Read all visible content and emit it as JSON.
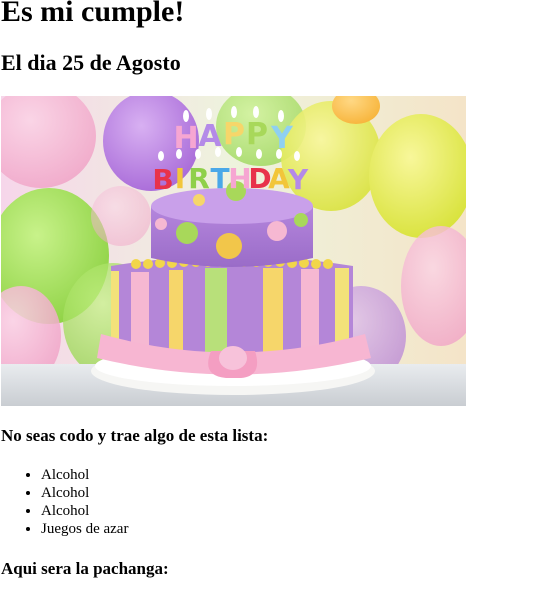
{
  "page": {
    "title": "Es mi cumple!",
    "date_heading": "El dia 25 de Agosto",
    "image": {
      "subject": "birthday-cake",
      "cake_text": "HAPPY BIRTHDAY"
    },
    "list_heading": "No seas codo y trae algo de esta lista:",
    "list_items": [
      "Alcohol",
      "Alcohol",
      "Alcohol",
      "Juegos de azar"
    ],
    "place_heading": "Aqui sera la pachanga:"
  }
}
